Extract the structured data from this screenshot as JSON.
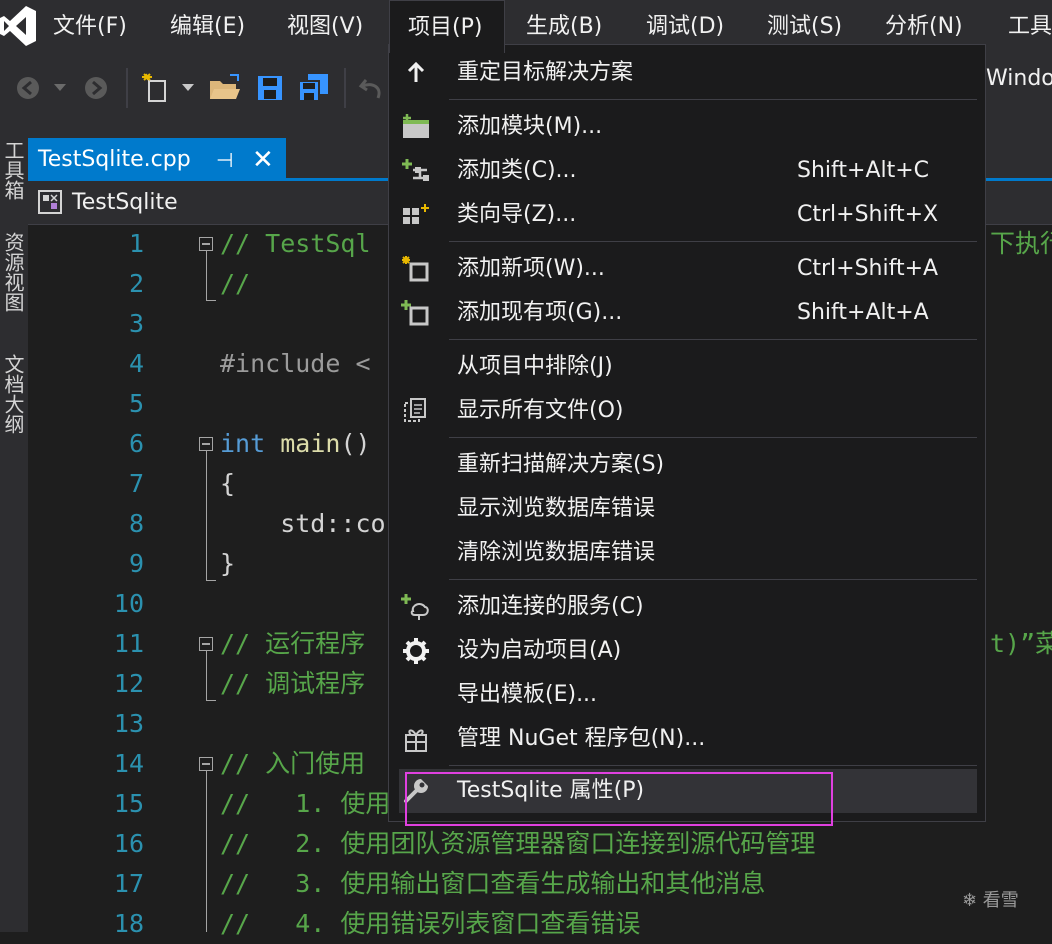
{
  "menubar": {
    "items": [
      {
        "label": "文件(F)"
      },
      {
        "label": "编辑(E)"
      },
      {
        "label": "视图(V)"
      },
      {
        "label": "项目(P)"
      },
      {
        "label": "生成(B)"
      },
      {
        "label": "调试(D)"
      },
      {
        "label": "测试(S)"
      },
      {
        "label": "分析(N)"
      },
      {
        "label": "工具"
      }
    ]
  },
  "toolbar": {
    "icons": [
      "back-arrow-icon",
      "dropdown-arrow-icon",
      "forward-arrow-icon",
      "new-item-icon",
      "open-folder-icon",
      "save-icon",
      "save-all-icon",
      "undo-icon"
    ],
    "platform_text": "Windo"
  },
  "left_strip": {
    "items": [
      "工具箱",
      "资源视图",
      "文档大纲"
    ]
  },
  "editor_tab": {
    "title": "TestSqlite.cpp",
    "pin_glyph": "⊣",
    "close_glyph": "✕"
  },
  "navbar": {
    "scope": "TestSqlite"
  },
  "code_lines": [
    {
      "n": "1",
      "text": "// TestSql"
    },
    {
      "n": "2",
      "text": "//"
    },
    {
      "n": "3",
      "text": ""
    },
    {
      "n": "4",
      "text": "#include <"
    },
    {
      "n": "5",
      "text": ""
    },
    {
      "n": "6",
      "kw": "int",
      "fn": "main",
      "rest": "()"
    },
    {
      "n": "7",
      "text": "{"
    },
    {
      "n": "8",
      "text": "    std::co"
    },
    {
      "n": "9",
      "text": "}"
    },
    {
      "n": "10",
      "text": ""
    },
    {
      "n": "11",
      "text": "// 运行程序"
    },
    {
      "n": "12",
      "text": "// 调试程序"
    },
    {
      "n": "13",
      "text": ""
    },
    {
      "n": "14",
      "text": "// 入门使用"
    },
    {
      "n": "15",
      "text": "//   1. 使用"
    },
    {
      "n": "16",
      "text": "//   2. 使用团队资源管理器窗口连接到源代码管理"
    },
    {
      "n": "17",
      "text": "//   3. 使用输出窗口查看生成输出和其他消息"
    },
    {
      "n": "18",
      "text": "//   4. 使用错误列表窗口查看错误"
    }
  ],
  "code_overflow_right": {
    "line1_tail": "下执行",
    "line11_tail": "t)”菜"
  },
  "project_menu": {
    "items": [
      {
        "label": "重定目标解决方案",
        "shortcut": "",
        "icon": "up-arrow-icon"
      },
      {
        "label": "添加模块(M)...",
        "shortcut": "",
        "icon": "add-module-icon"
      },
      {
        "label": "添加类(C)...",
        "shortcut": "Shift+Alt+C",
        "icon": "add-class-icon"
      },
      {
        "label": "类向导(Z)...",
        "shortcut": "Ctrl+Shift+X",
        "icon": "class-wizard-icon"
      },
      {
        "label": "添加新项(W)...",
        "shortcut": "Ctrl+Shift+A",
        "icon": "add-new-item-icon"
      },
      {
        "label": "添加现有项(G)...",
        "shortcut": "Shift+Alt+A",
        "icon": "add-existing-item-icon"
      },
      {
        "label": "从项目中排除(J)",
        "shortcut": "",
        "icon": ""
      },
      {
        "label": "显示所有文件(O)",
        "shortcut": "",
        "icon": "show-all-files-icon"
      },
      {
        "label": "重新扫描解决方案(S)",
        "shortcut": "",
        "icon": ""
      },
      {
        "label": "显示浏览数据库错误",
        "shortcut": "",
        "icon": ""
      },
      {
        "label": "清除浏览数据库错误",
        "shortcut": "",
        "icon": ""
      },
      {
        "label": "添加连接的服务(C)",
        "shortcut": "",
        "icon": "connected-service-icon"
      },
      {
        "label": "设为启动项目(A)",
        "shortcut": "",
        "icon": "gear-icon"
      },
      {
        "label": "导出模板(E)...",
        "shortcut": "",
        "icon": ""
      },
      {
        "label": "管理 NuGet 程序包(N)...",
        "shortcut": "",
        "icon": "nuget-package-icon"
      },
      {
        "label": "TestSqlite 属性(P)",
        "shortcut": "",
        "icon": "wrench-icon"
      }
    ]
  },
  "watermark": "❄ 看雪",
  "colors": {
    "accent": "#007acc",
    "highlight_box": "#e040e0",
    "comment": "#57a64a",
    "keyword": "#569cd6",
    "line_number": "#2b91af"
  }
}
